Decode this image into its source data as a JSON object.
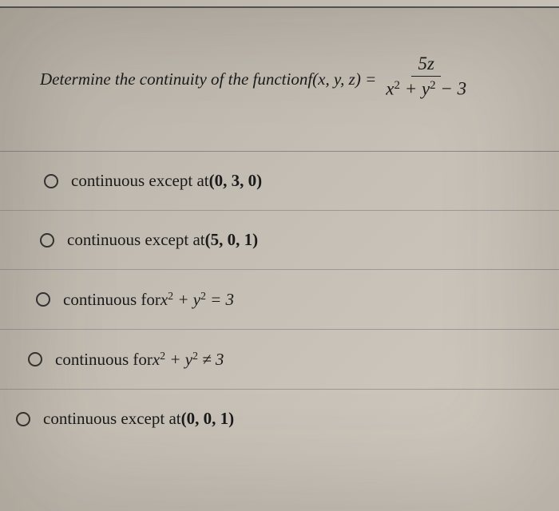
{
  "question": {
    "prompt_prefix": "Determine the continuity of the function ",
    "func_lhs": "f(x, y, z) = ",
    "frac_num": "5z",
    "frac_den_html": "x<span class='sup'>2</span> + y<span class='sup'>2</span> − 3"
  },
  "options": [
    {
      "text_html": "continuous except at <span class='paren'>(0, 3, 0)</span>"
    },
    {
      "text_html": "continuous except at <span class='paren'>(5, 0, 1)</span>"
    },
    {
      "text_html": "continuous for <span class='math'>x<span class='sup'>2</span> + y<span class='sup'>2</span> = 3</span>"
    },
    {
      "text_html": "continuous for <span class='math'>x<span class='sup'>2</span> + y<span class='sup'>2</span> ≠ 3</span>"
    },
    {
      "text_html": "continuous except at <span class='paren'>(0, 0, 1)</span>"
    }
  ]
}
